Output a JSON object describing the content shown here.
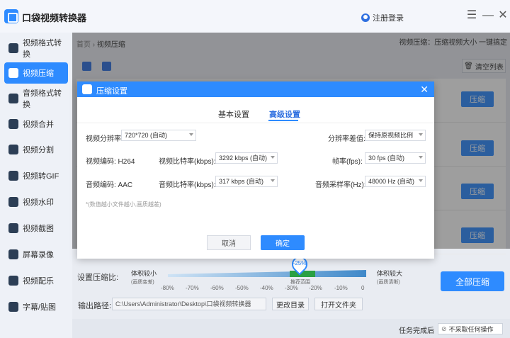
{
  "app": {
    "title": "口袋视频转换器",
    "login_label": "注册登录"
  },
  "sidebar": {
    "items": [
      {
        "label": "视频格式转换",
        "icon": "video-convert-icon"
      },
      {
        "label": "视频压缩",
        "icon": "video-compress-icon"
      },
      {
        "label": "音频格式转换",
        "icon": "audio-convert-icon"
      },
      {
        "label": "视频合并",
        "icon": "video-merge-icon"
      },
      {
        "label": "视频分割",
        "icon": "video-split-icon"
      },
      {
        "label": "视频转GIF",
        "icon": "gif-icon"
      },
      {
        "label": "视频水印",
        "icon": "watermark-icon"
      },
      {
        "label": "视频截图",
        "icon": "screenshot-icon"
      },
      {
        "label": "屏幕录像",
        "icon": "screen-record-icon"
      },
      {
        "label": "视频配乐",
        "icon": "music-icon"
      },
      {
        "label": "字幕/贴图",
        "icon": "subtitle-icon"
      }
    ],
    "active_index": 1
  },
  "main": {
    "breadcrumb_home": "首页",
    "breadcrumb_sep": "›",
    "breadcrumb_current": "视频压缩",
    "top_hint": "视频压缩：压缩视频大小 一键搞定",
    "clear_label": "清空列表",
    "row_button_label": "压缩"
  },
  "bottom": {
    "compress_ratio_label": "设置压缩比:",
    "small_label": "体积较小",
    "small_sub": "(画质变差)",
    "large_label": "体积较大",
    "large_sub": "(画质清晰)",
    "ratio_value": "-25%",
    "recommend_label": "推荐范围",
    "ticks": [
      "-80%",
      "-70%",
      "-60%",
      "-50%",
      "-40%",
      "-30%",
      "-20%",
      "-10%",
      "0"
    ],
    "all_compress_label": "全部压缩",
    "output_path_label": "输出路径:",
    "output_path_value": "C:\\Users\\Administrator\\Desktop\\口袋视频转换器",
    "change_dir_label": "更改目录",
    "open_folder_label": "打开文件夹",
    "after_task_label": "任务完成后",
    "after_task_value": "不采取任何操作"
  },
  "dialog": {
    "title": "压缩设置",
    "tab_basic": "基本设置",
    "tab_advanced": "高级设置",
    "resolution_label": "视频分辨率:",
    "resolution_value": "720*720 (自动)",
    "resolution_diff_label": "分辨率差值:",
    "resolution_diff_value": "保持原视频比例",
    "video_codec_label": "视频编码: H264",
    "video_bitrate_label": "视频比特率(kbps):",
    "video_bitrate_value": "3292 kbps (自动)",
    "fps_label": "帧率(fps):",
    "fps_value": "30 fps (自动)",
    "audio_codec_label": "音频编码: AAC",
    "audio_bitrate_label": "音频比特率(kbps):",
    "audio_bitrate_value": "317 kbps (自动)",
    "sample_rate_label": "音频采样率(Hz):",
    "sample_rate_value": "48000 Hz (自动)",
    "note": "*(数值越小文件越小,画质越差)",
    "cancel_label": "取消",
    "ok_label": "确定"
  },
  "colors": {
    "accent": "#2e8bff",
    "sidebar_bg": "#eef1f7",
    "recommend": "#2aa043"
  }
}
